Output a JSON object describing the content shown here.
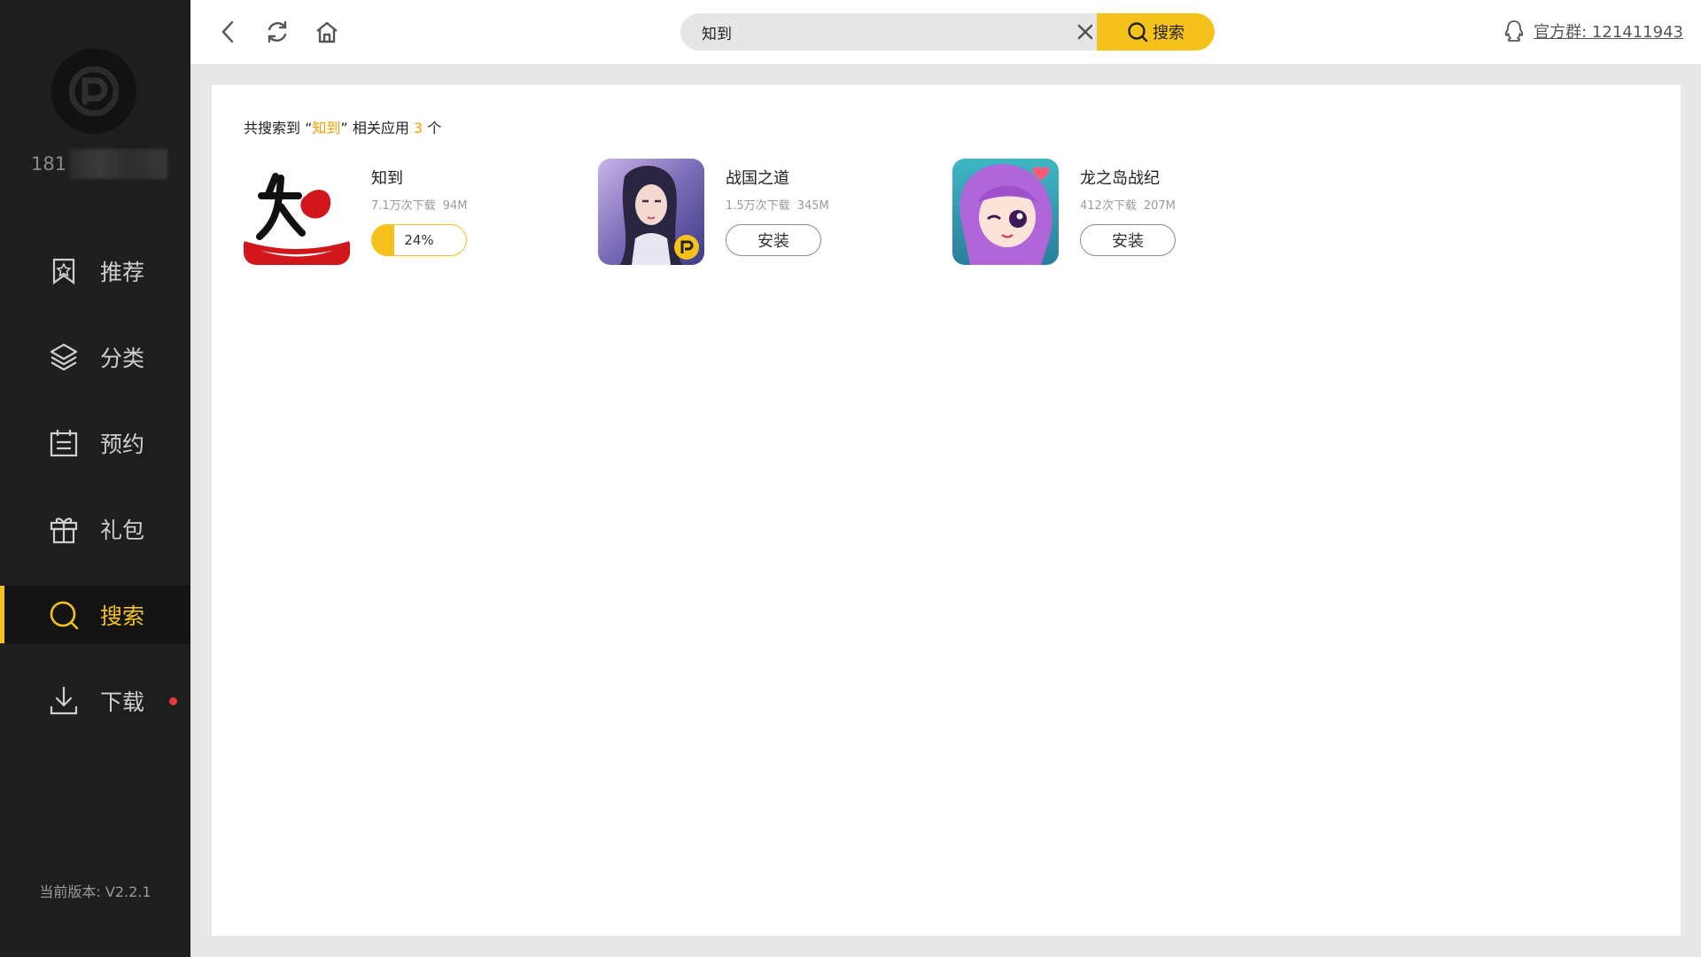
{
  "sidebar": {
    "user_id": "181",
    "items": [
      {
        "label": "推荐",
        "icon": "bookmark-icon"
      },
      {
        "label": "分类",
        "icon": "layers-icon"
      },
      {
        "label": "预约",
        "icon": "calendar-icon"
      },
      {
        "label": "礼包",
        "icon": "gift-icon"
      },
      {
        "label": "搜索",
        "icon": "search-icon",
        "active": true
      },
      {
        "label": "下载",
        "icon": "download-icon",
        "badge": "red-dot"
      }
    ],
    "version": "当前版本: V2.2.1"
  },
  "topbar": {
    "search_value": "知到",
    "search_button": "搜索",
    "official_group": "官方群: 121411943"
  },
  "results": {
    "prefix": "共搜索到",
    "open_quote": "“",
    "keyword": "知到",
    "close_quote": "”",
    "middle": "相关应用",
    "count": "3",
    "suffix": "个"
  },
  "apps": [
    {
      "name": "知到",
      "downloads": "7.1万次下载",
      "size": "94M",
      "progress": 24,
      "progress_label": "24%"
    },
    {
      "name": "战国之道",
      "downloads": "1.5万次下载",
      "size": "345M",
      "action": "安装"
    },
    {
      "name": "龙之岛战纪",
      "downloads": "412次下载",
      "size": "207M",
      "action": "安装"
    }
  ],
  "colors": {
    "accent": "#f5c21b",
    "sidebar_bg": "#1e1e1e",
    "badge": "#e63a3a",
    "highlight": "#f2a000"
  }
}
